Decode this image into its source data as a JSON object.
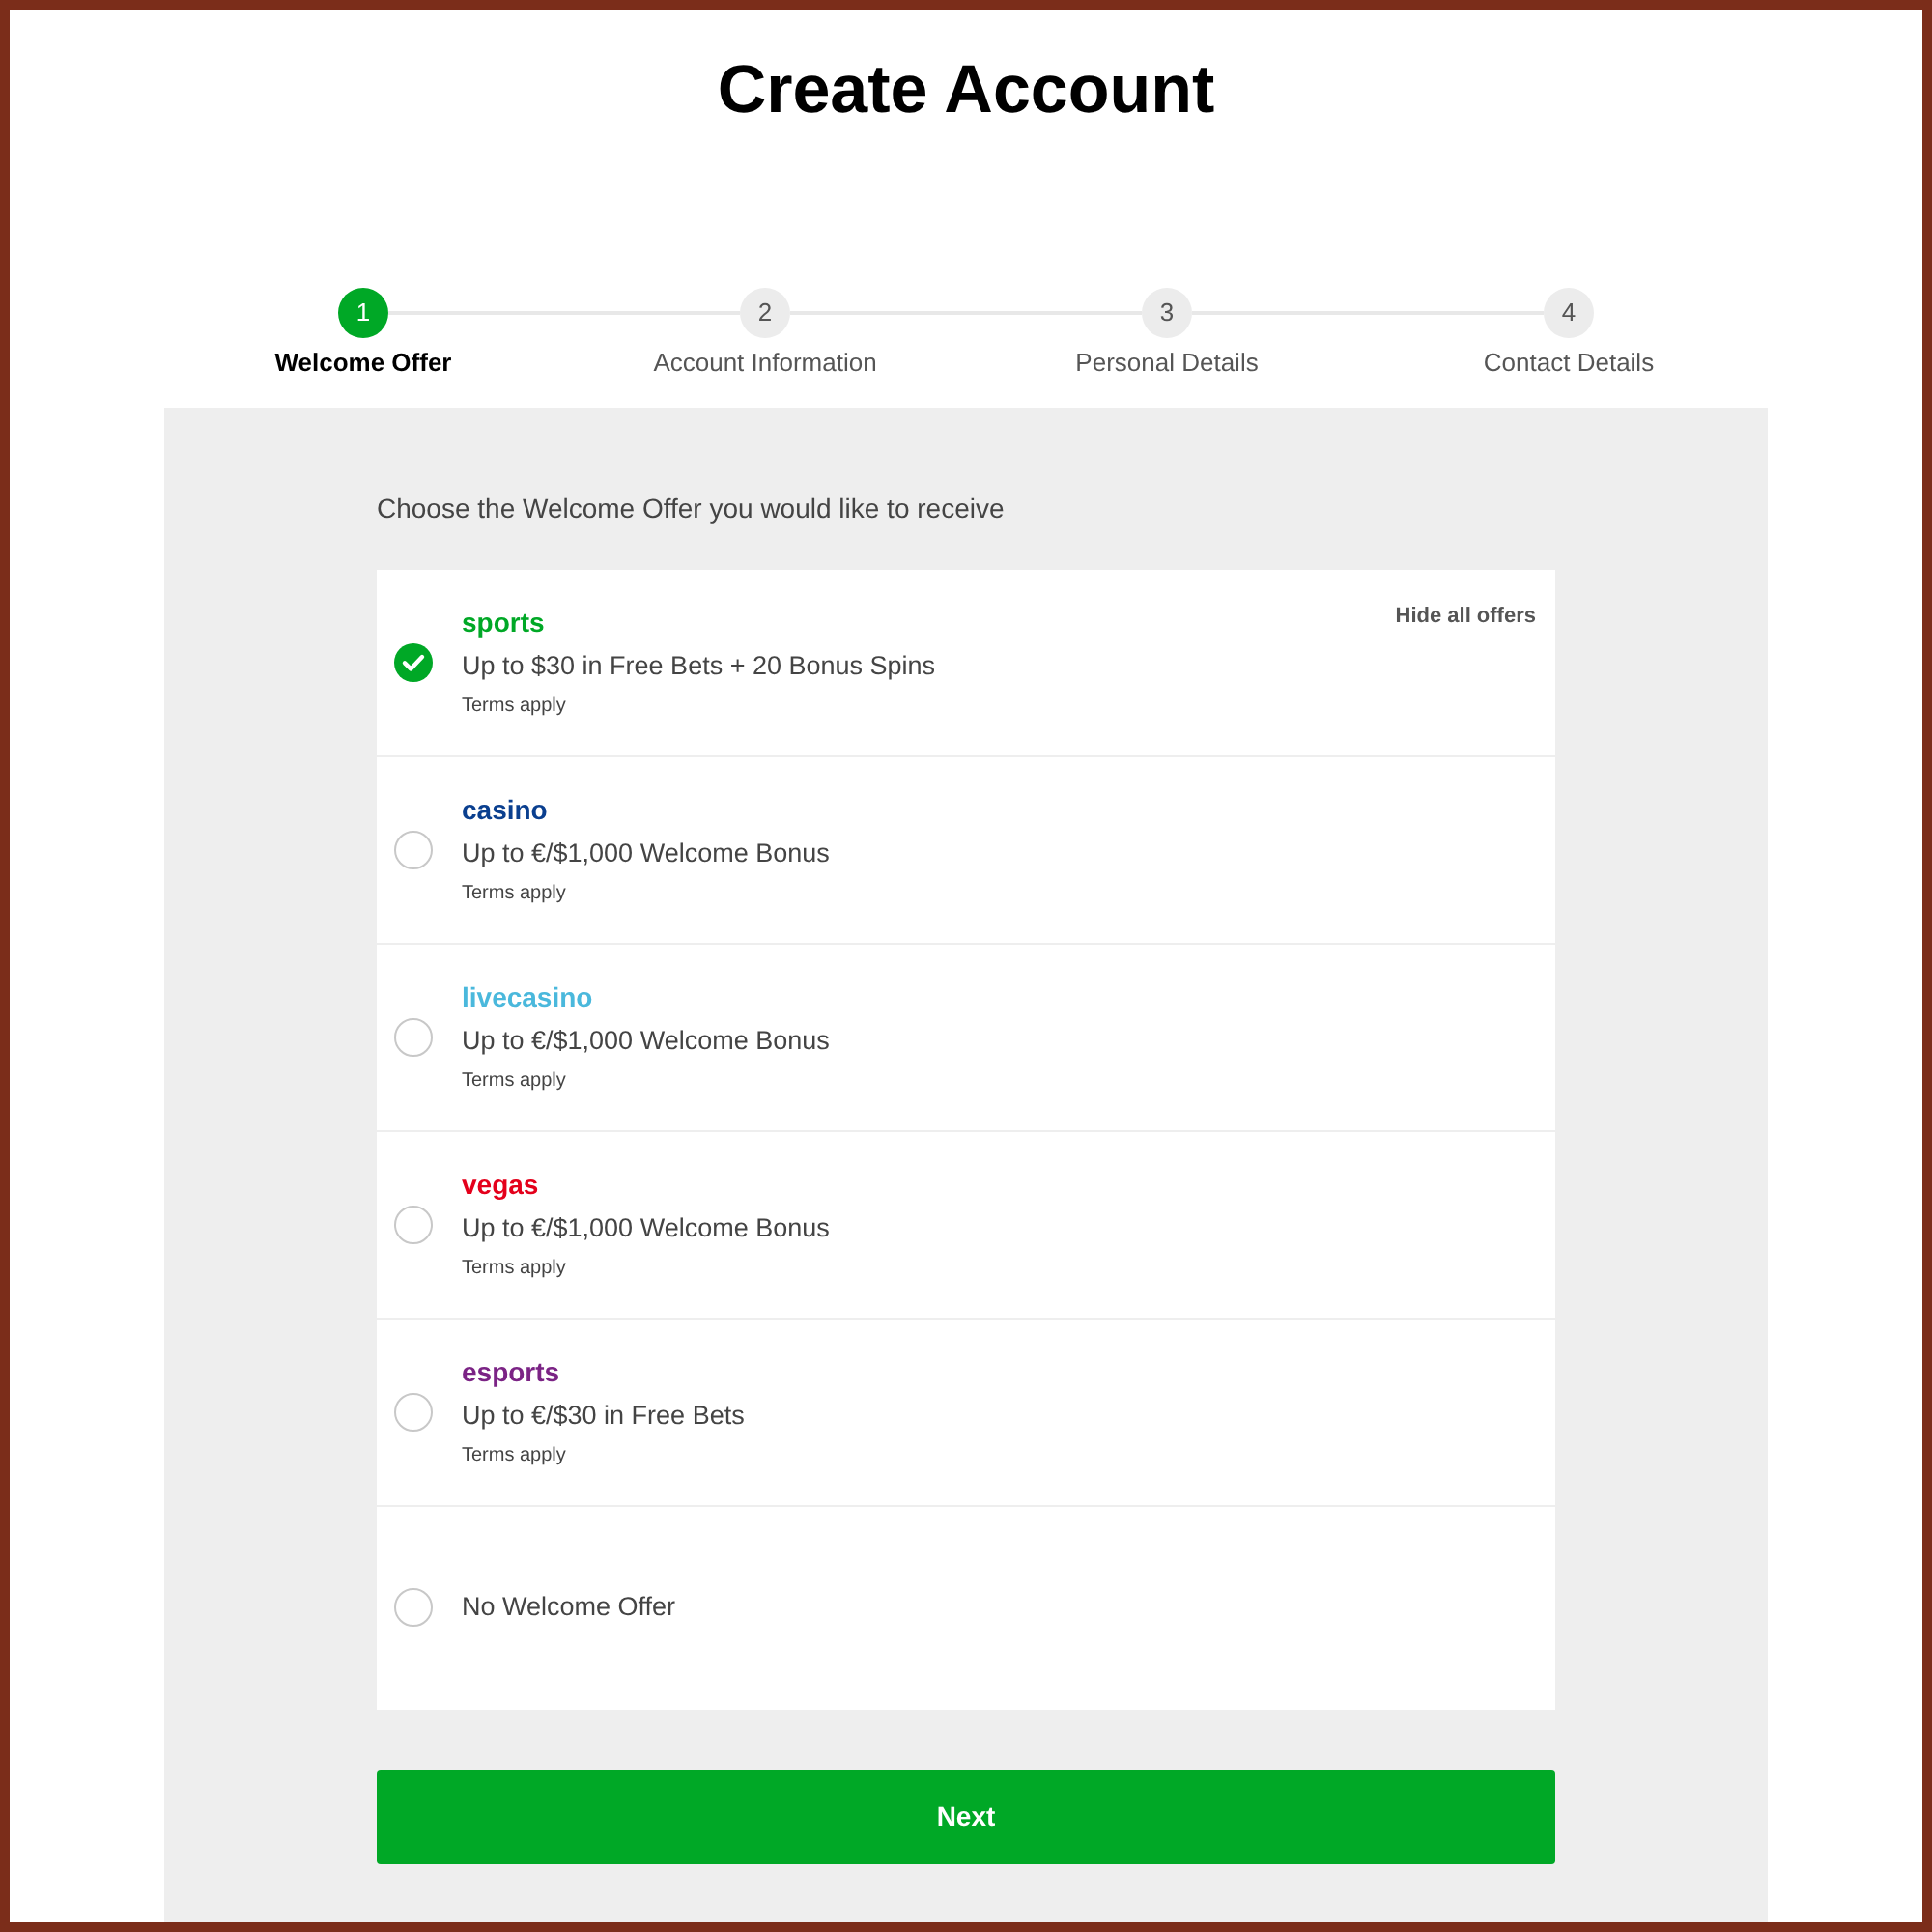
{
  "title": "Create Account",
  "steps": [
    {
      "number": "1",
      "label": "Welcome Offer",
      "selected": true
    },
    {
      "number": "2",
      "label": "Account Information",
      "selected": false
    },
    {
      "number": "3",
      "label": "Personal Details",
      "selected": false
    },
    {
      "number": "4",
      "label": "Contact Details",
      "selected": false
    }
  ],
  "prompt": "Choose the Welcome Offer you would like to receive",
  "offers_card": {
    "hide_link": "Hide all offers",
    "offers": [
      {
        "kind": "brand",
        "brand": "sports",
        "color": "#00a826",
        "description": "Up to $30 in Free Bets + 20 Bonus Spins",
        "terms": "Terms apply",
        "selected": true
      },
      {
        "kind": "brand",
        "brand": "casino",
        "color": "#0a3f8f",
        "description": "Up to €/$1,000 Welcome Bonus",
        "terms": "Terms apply",
        "selected": false
      },
      {
        "kind": "brand",
        "brand": "livecasino",
        "color": "#4ab8dc",
        "description": "Up to €/$1,000 Welcome Bonus",
        "terms": "Terms apply",
        "selected": false
      },
      {
        "kind": "brand",
        "brand": "vegas",
        "color": "#e4001b",
        "description": "Up to €/$1,000 Welcome Bonus",
        "terms": "Terms apply",
        "selected": false
      },
      {
        "kind": "brand",
        "brand": "esports",
        "color": "#7b2385",
        "description": "Up to €/$30 in Free Bets",
        "terms": "Terms apply",
        "selected": false
      },
      {
        "kind": "plain",
        "description": "No Welcome Offer",
        "selected": false
      }
    ]
  },
  "next_button": "Next"
}
